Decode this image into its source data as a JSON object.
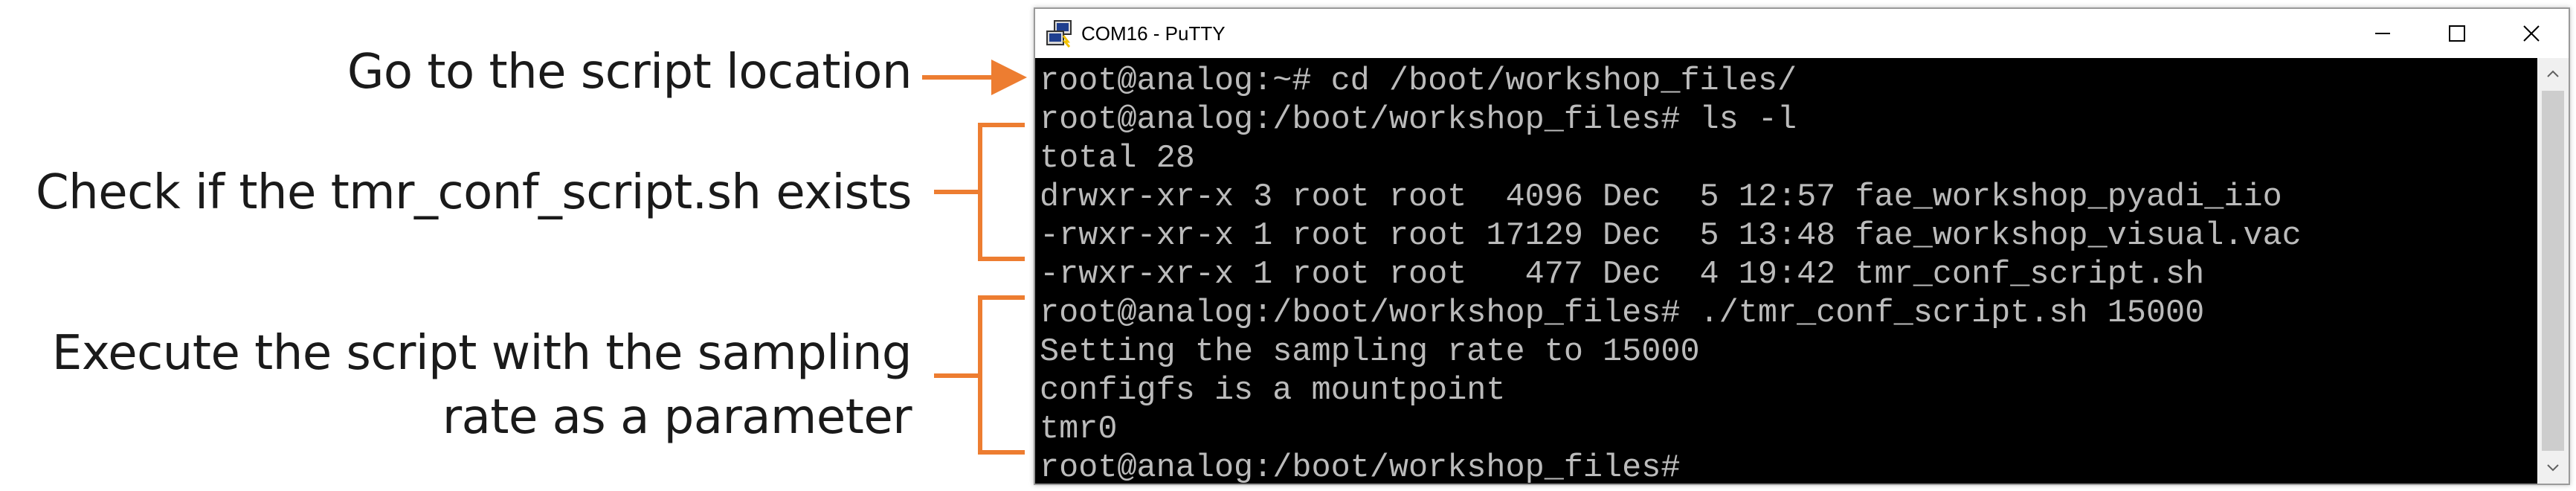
{
  "annotations": {
    "step1": "Go to the script location",
    "step2": "Check if the tmr_conf_script.sh exists",
    "step3_line1": "Execute the script with the sampling",
    "step3_line2": "rate as a parameter"
  },
  "colors": {
    "annotation_arrow": "#ed7d31",
    "terminal_bg": "#000000",
    "terminal_text": "#bbbbbb"
  },
  "window": {
    "title": "COM16 - PuTTY",
    "icon": "putty-icon"
  },
  "terminal": {
    "lines": [
      "root@analog:~# cd /boot/workshop_files/",
      "root@analog:/boot/workshop_files# ls -l",
      "total 28",
      "drwxr-xr-x 3 root root  4096 Dec  5 12:57 fae_workshop_pyadi_iio",
      "-rwxr-xr-x 1 root root 17129 Dec  5 13:48 fae_workshop_visual.vac",
      "-rwxr-xr-x 1 root root   477 Dec  4 19:42 tmr_conf_script.sh",
      "root@analog:/boot/workshop_files# ./tmr_conf_script.sh 15000",
      "Setting the sampling rate to 15000",
      "configfs is a mountpoint",
      "tmr0",
      "root@analog:/boot/workshop_files# "
    ]
  }
}
